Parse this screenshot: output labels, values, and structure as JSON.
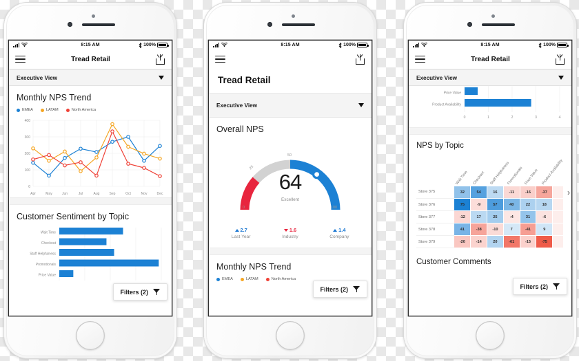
{
  "status_bar": {
    "time": "8:15 AM",
    "battery_pct": "100%",
    "signal_icon": "signal-bars-icon",
    "wifi_icon": "wifi-icon",
    "bluetooth_icon": "bluetooth-icon"
  },
  "nav": {
    "title": "Tread Retail",
    "menu_icon": "hamburger-menu-icon",
    "share_icon": "share-icon"
  },
  "view_selector": {
    "label": "Executive View",
    "caret_icon": "caret-down-icon"
  },
  "filters": {
    "label": "Filters (2)",
    "icon": "filter-funnel-icon"
  },
  "colors": {
    "blue": "#1C81D4",
    "amber": "#F5A623",
    "red": "#EF4136",
    "gauge_red": "#E8253E",
    "gauge_gray": "#D2D2D2",
    "gauge_blue": "#1C81D4"
  },
  "phone1": {
    "section1_title": "Monthly NPS Trend",
    "section2_title": "Customer Sentiment by Topic"
  },
  "phone2": {
    "page_title": "Tread Retail",
    "section1_title": "Overall NPS",
    "section2_title": "Monthly NPS Trend",
    "gauge": {
      "value": "64",
      "rating": "Excellent",
      "ticks": [
        "0",
        "25",
        "50",
        "100"
      ],
      "min": 0,
      "max": 100
    },
    "kpis": [
      {
        "value": "2.7",
        "label": "Last Year",
        "direction": "up"
      },
      {
        "value": "1.6",
        "label": "Industry",
        "direction": "down"
      },
      {
        "value": "1.4",
        "label": "Company",
        "direction": "up"
      }
    ]
  },
  "phone3": {
    "section1_title": "NPS by Topic",
    "section2_title": "Customer Comments",
    "next_icon": "chevron-right-icon"
  },
  "chart_data": [
    {
      "type": "line",
      "title": "Monthly NPS Trend",
      "xlabel": "",
      "ylabel": "",
      "categories": [
        "Apr",
        "May",
        "Jun",
        "Jul",
        "Aug",
        "Sep",
        "Oct",
        "Nov",
        "Dec"
      ],
      "yticks": [
        0,
        100,
        200,
        300,
        400
      ],
      "ylim": [
        0,
        400
      ],
      "grid": true,
      "legend_position": "top-left",
      "series": [
        {
          "name": "EMEA",
          "color": "#1C81D4",
          "values": [
            143,
            65,
            172,
            228,
            208,
            270,
            300,
            155,
            245
          ]
        },
        {
          "name": "LATAM",
          "color": "#F5A623",
          "values": [
            230,
            155,
            211,
            92,
            175,
            377,
            240,
            198,
            168
          ]
        },
        {
          "name": "North America",
          "color": "#EF4136",
          "values": [
            163,
            190,
            127,
            146,
            65,
            333,
            137,
            112,
            62
          ]
        }
      ]
    },
    {
      "type": "bar",
      "orientation": "horizontal",
      "title": "Customer Sentiment by Topic",
      "categories": [
        "Wait Time",
        "Checkout",
        "Staff Helpfulness",
        "Promotionals",
        "Price Value"
      ],
      "values": [
        2.5,
        1.85,
        2.15,
        3.9,
        0.55
      ],
      "xlim": [
        0,
        4
      ],
      "color": "#1C81D4"
    },
    {
      "type": "bar",
      "orientation": "horizontal",
      "title": "Customer Sentiment by Topic",
      "categories": [
        "Price Value",
        "Product Availability"
      ],
      "values": [
        0.55,
        2.8
      ],
      "xticks": [
        "0",
        "1",
        "2",
        "3",
        "4"
      ],
      "xlim": [
        0,
        4
      ],
      "color": "#1C81D4"
    },
    {
      "type": "heatmap",
      "title": "NPS by Topic",
      "columns": [
        "Wait Time",
        "Checkout",
        "Staff Helpfulness",
        "Promotionals",
        "Price Value",
        "Product Availability"
      ],
      "rows": [
        "Store 375",
        "Store 376",
        "Store 377",
        "Store 378",
        "Store 379"
      ],
      "values": [
        [
          32,
          54,
          16,
          -11,
          -16,
          -37
        ],
        [
          75,
          -9,
          57,
          40,
          22,
          18
        ],
        [
          -12,
          17,
          25,
          -4,
          31,
          -6
        ],
        [
          41,
          -38,
          -10,
          7,
          -41,
          9
        ],
        [
          -20,
          -14,
          20,
          -61,
          -15,
          -75
        ]
      ],
      "colorscale": {
        "negative": "#EF5B49",
        "neutral": "#FFFFFF",
        "positive": "#1C81D4"
      }
    }
  ]
}
